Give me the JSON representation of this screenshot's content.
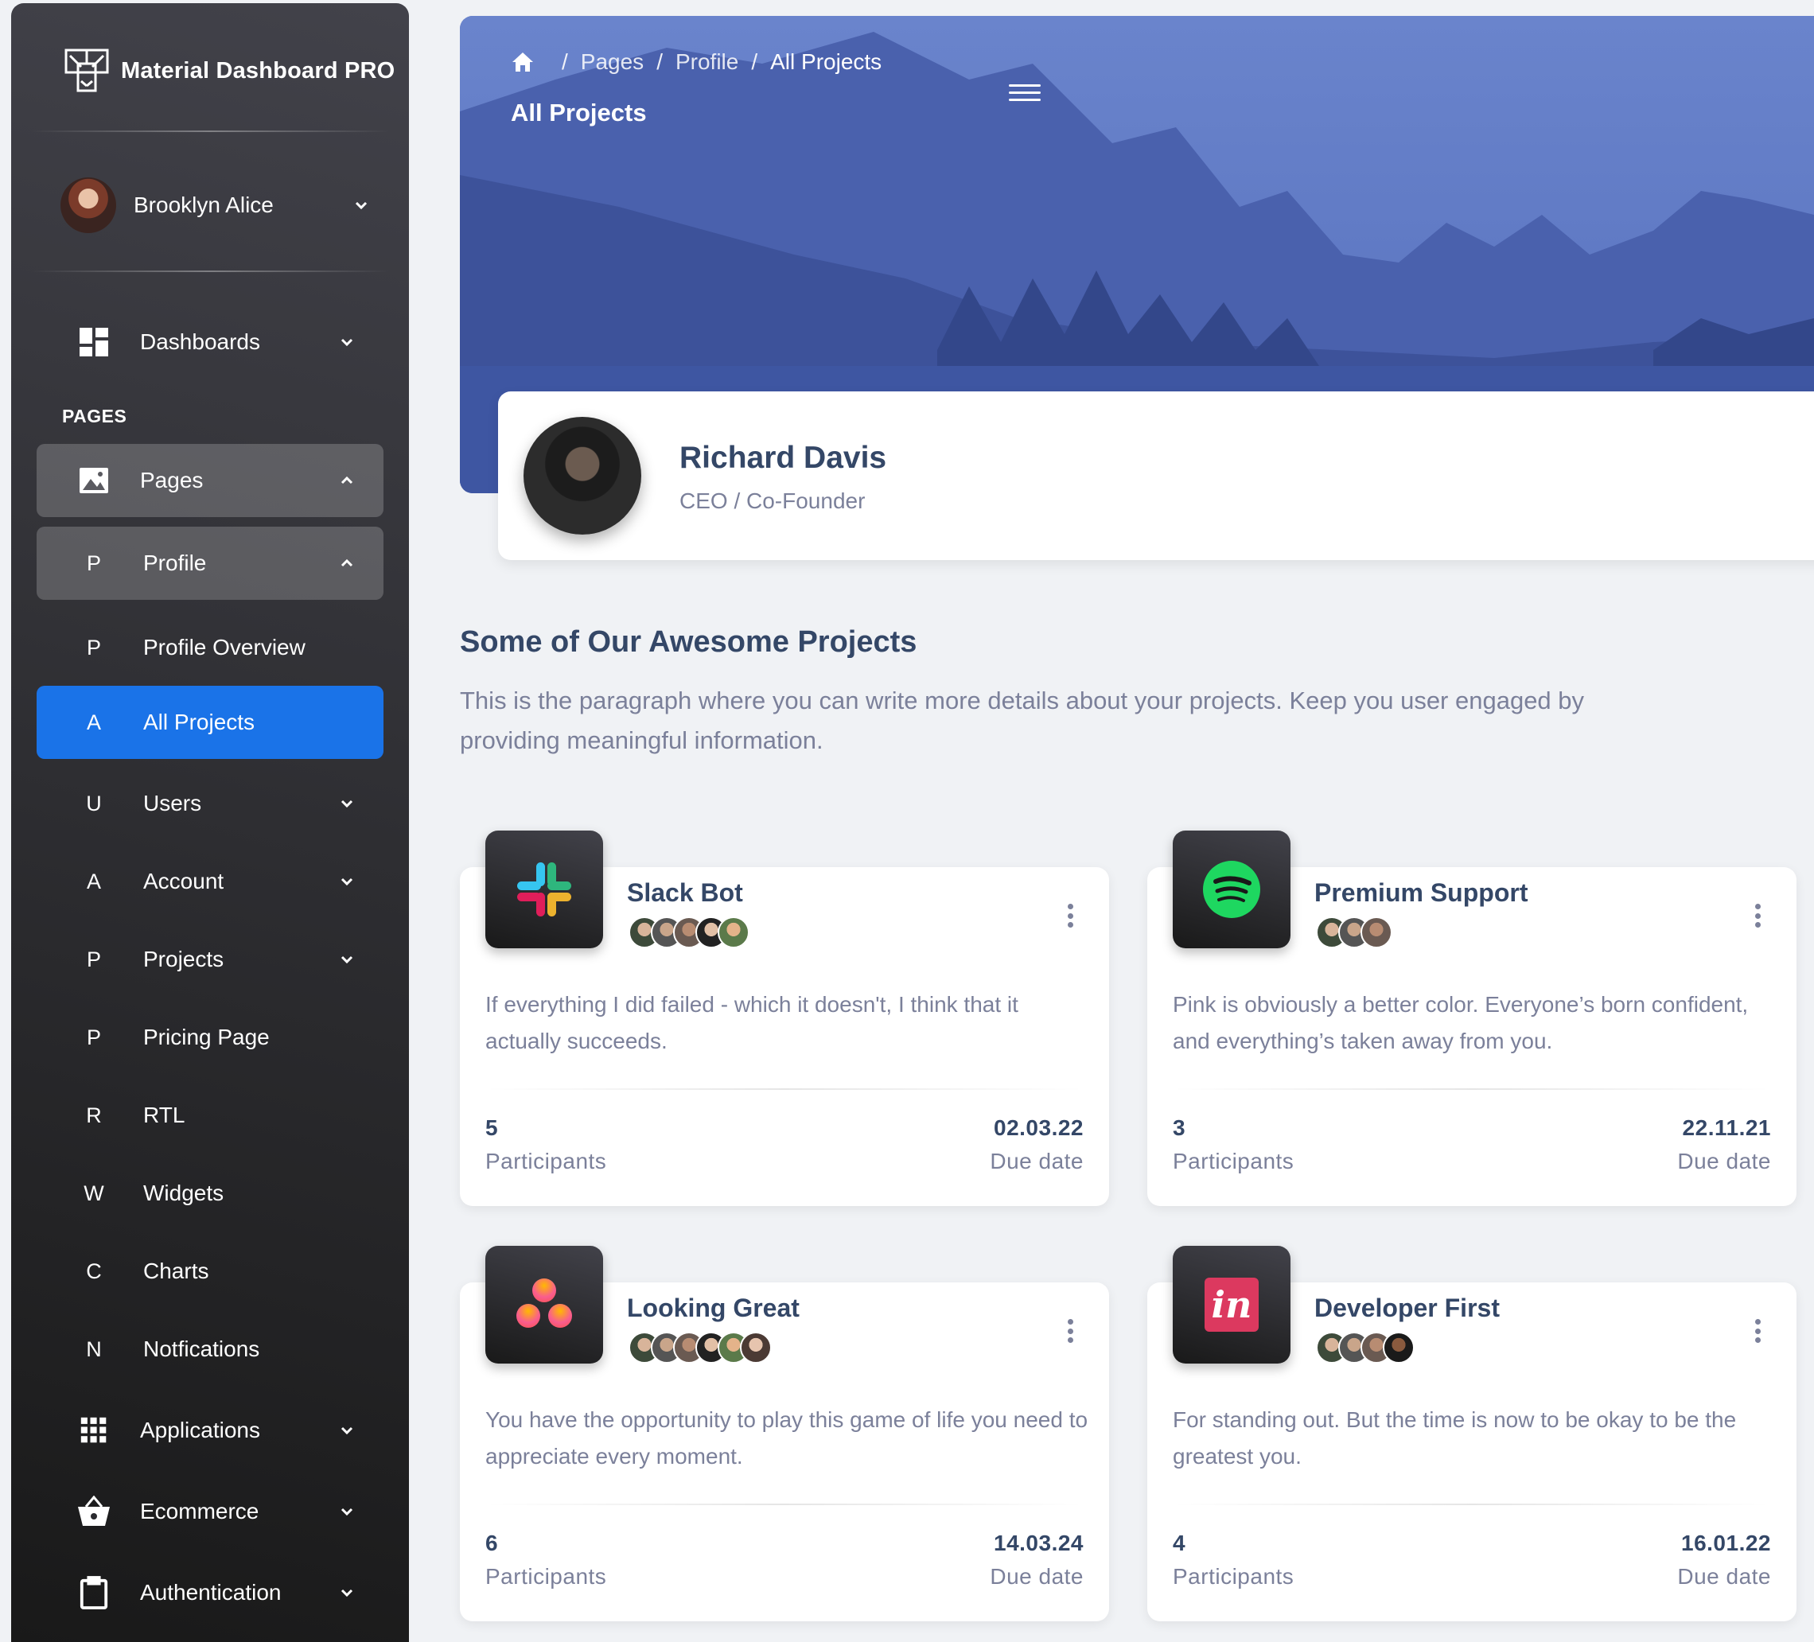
{
  "brand": {
    "name": "Material Dashboard PRO"
  },
  "user": {
    "name": "Brooklyn Alice"
  },
  "sidebar": {
    "dashboards": "Dashboards",
    "pages_heading": "PAGES",
    "items": [
      {
        "label": "Pages",
        "icon": "image-icon"
      },
      {
        "letter": "P",
        "label": "Profile"
      },
      {
        "letter": "P",
        "label": "Profile Overview"
      },
      {
        "letter": "A",
        "label": "All Projects"
      },
      {
        "letter": "U",
        "label": "Users"
      },
      {
        "letter": "A",
        "label": "Account"
      },
      {
        "letter": "P",
        "label": "Projects"
      },
      {
        "letter": "P",
        "label": "Pricing Page"
      },
      {
        "letter": "R",
        "label": "RTL"
      },
      {
        "letter": "W",
        "label": "Widgets"
      },
      {
        "letter": "C",
        "label": "Charts"
      },
      {
        "letter": "N",
        "label": "Notfications"
      },
      {
        "label": "Applications",
        "icon": "apps-icon"
      },
      {
        "label": "Ecommerce",
        "icon": "basket-icon"
      },
      {
        "label": "Authentication",
        "icon": "clipboard-icon"
      }
    ]
  },
  "header": {
    "breadcrumbs": [
      "Pages",
      "Profile",
      "All Projects"
    ],
    "title": "All Projects"
  },
  "profile": {
    "name": "Richard Davis",
    "role": "CEO / Co-Founder"
  },
  "section": {
    "title": "Some of Our Awesome Projects",
    "description": "This is the paragraph where you can write more details about your projects. Keep you user engaged by providing meaningful information."
  },
  "projects": [
    {
      "title": "Slack Bot",
      "logo": "slack-logo",
      "members": 5,
      "text": "If everything I did failed - which it doesn't, I think that it actually succeeds.",
      "participants": "5",
      "participants_label": "Participants",
      "due": "02.03.22",
      "due_label": "Due date"
    },
    {
      "title": "Premium Support",
      "logo": "spotify-logo",
      "members": 3,
      "text": "Pink is obviously a better color. Everyone’s born confident, and everything’s taken away from you.",
      "participants": "3",
      "participants_label": "Participants",
      "due": "22.11.21",
      "due_label": "Due date"
    },
    {
      "title": "Looking Great",
      "logo": "asana-logo",
      "members": 6,
      "text": "You have the opportunity to play this game of life you need to appreciate every moment.",
      "participants": "6",
      "participants_label": "Participants",
      "due": "14.03.24",
      "due_label": "Due date"
    },
    {
      "title": "Developer First",
      "logo": "invision-logo",
      "logo_text": "in",
      "members": 4,
      "text": "For standing out. But the time is now to be okay to be the greatest you.",
      "participants": "4",
      "participants_label": "Participants",
      "due": "16.01.22",
      "due_label": "Due date"
    }
  ],
  "colors": {
    "accent": "#1A73E8",
    "sidebar_dark": "#191919",
    "heading": "#344767",
    "muted": "#7b809a"
  }
}
